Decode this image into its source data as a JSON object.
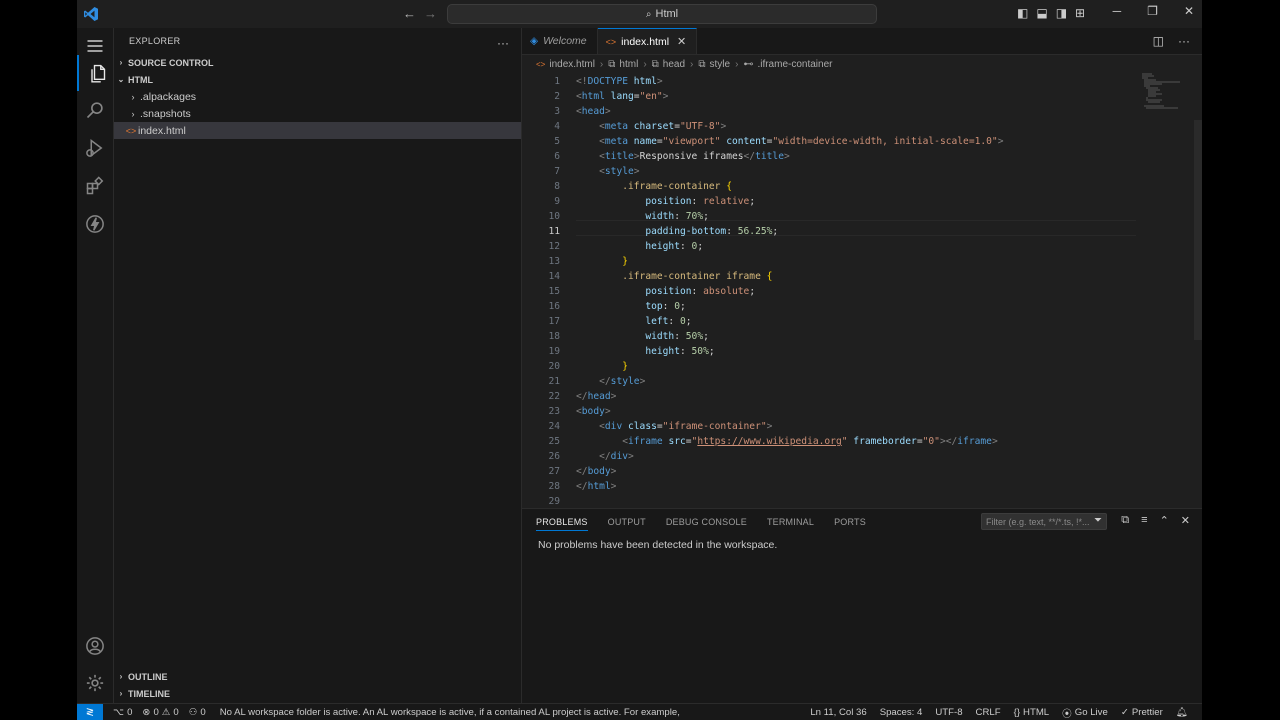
{
  "title_bar": {
    "search_text": "Html"
  },
  "sidebar": {
    "header": "EXPLORER",
    "source_control": "SOURCE CONTROL",
    "folder": "HTML",
    "items": [
      {
        "label": ".alpackages",
        "type": "folder"
      },
      {
        "label": ".snapshots",
        "type": "folder"
      },
      {
        "label": "index.html",
        "type": "file"
      }
    ],
    "outline": "OUTLINE",
    "timeline": "TIMELINE"
  },
  "tabs": [
    {
      "label": "Welcome",
      "active": false
    },
    {
      "label": "index.html",
      "active": true
    }
  ],
  "breadcrumb": [
    "index.html",
    "html",
    "head",
    "style",
    ".iframe-container"
  ],
  "editor": {
    "current_line": 11,
    "lines": [
      "1",
      "2",
      "3",
      "4",
      "5",
      "6",
      "7",
      "8",
      "9",
      "10",
      "11",
      "12",
      "13",
      "14",
      "15",
      "16",
      "17",
      "18",
      "19",
      "20",
      "21",
      "22",
      "23",
      "24",
      "25",
      "26",
      "27",
      "28",
      "29"
    ]
  },
  "panel": {
    "tabs": [
      "PROBLEMS",
      "OUTPUT",
      "DEBUG CONSOLE",
      "TERMINAL",
      "PORTS"
    ],
    "filter_placeholder": "Filter (e.g. text, **/*.ts, !*...",
    "message": "No problems have been detected in the workspace."
  },
  "status": {
    "ports": "0",
    "errors": "0",
    "warnings": "0",
    "info": "0",
    "message": "No AL workspace folder is active. An AL workspace is active, if a contained AL project is active. For example,",
    "cursor": "Ln 11, Col 36",
    "spaces": "Spaces: 4",
    "encoding": "UTF-8",
    "eol": "CRLF",
    "language": "HTML",
    "golive": "Go Live",
    "prettier": "Prettier"
  },
  "colors": {
    "accent": "#0078d4",
    "bg": "#1f1f1f",
    "sidebar": "#181818"
  }
}
